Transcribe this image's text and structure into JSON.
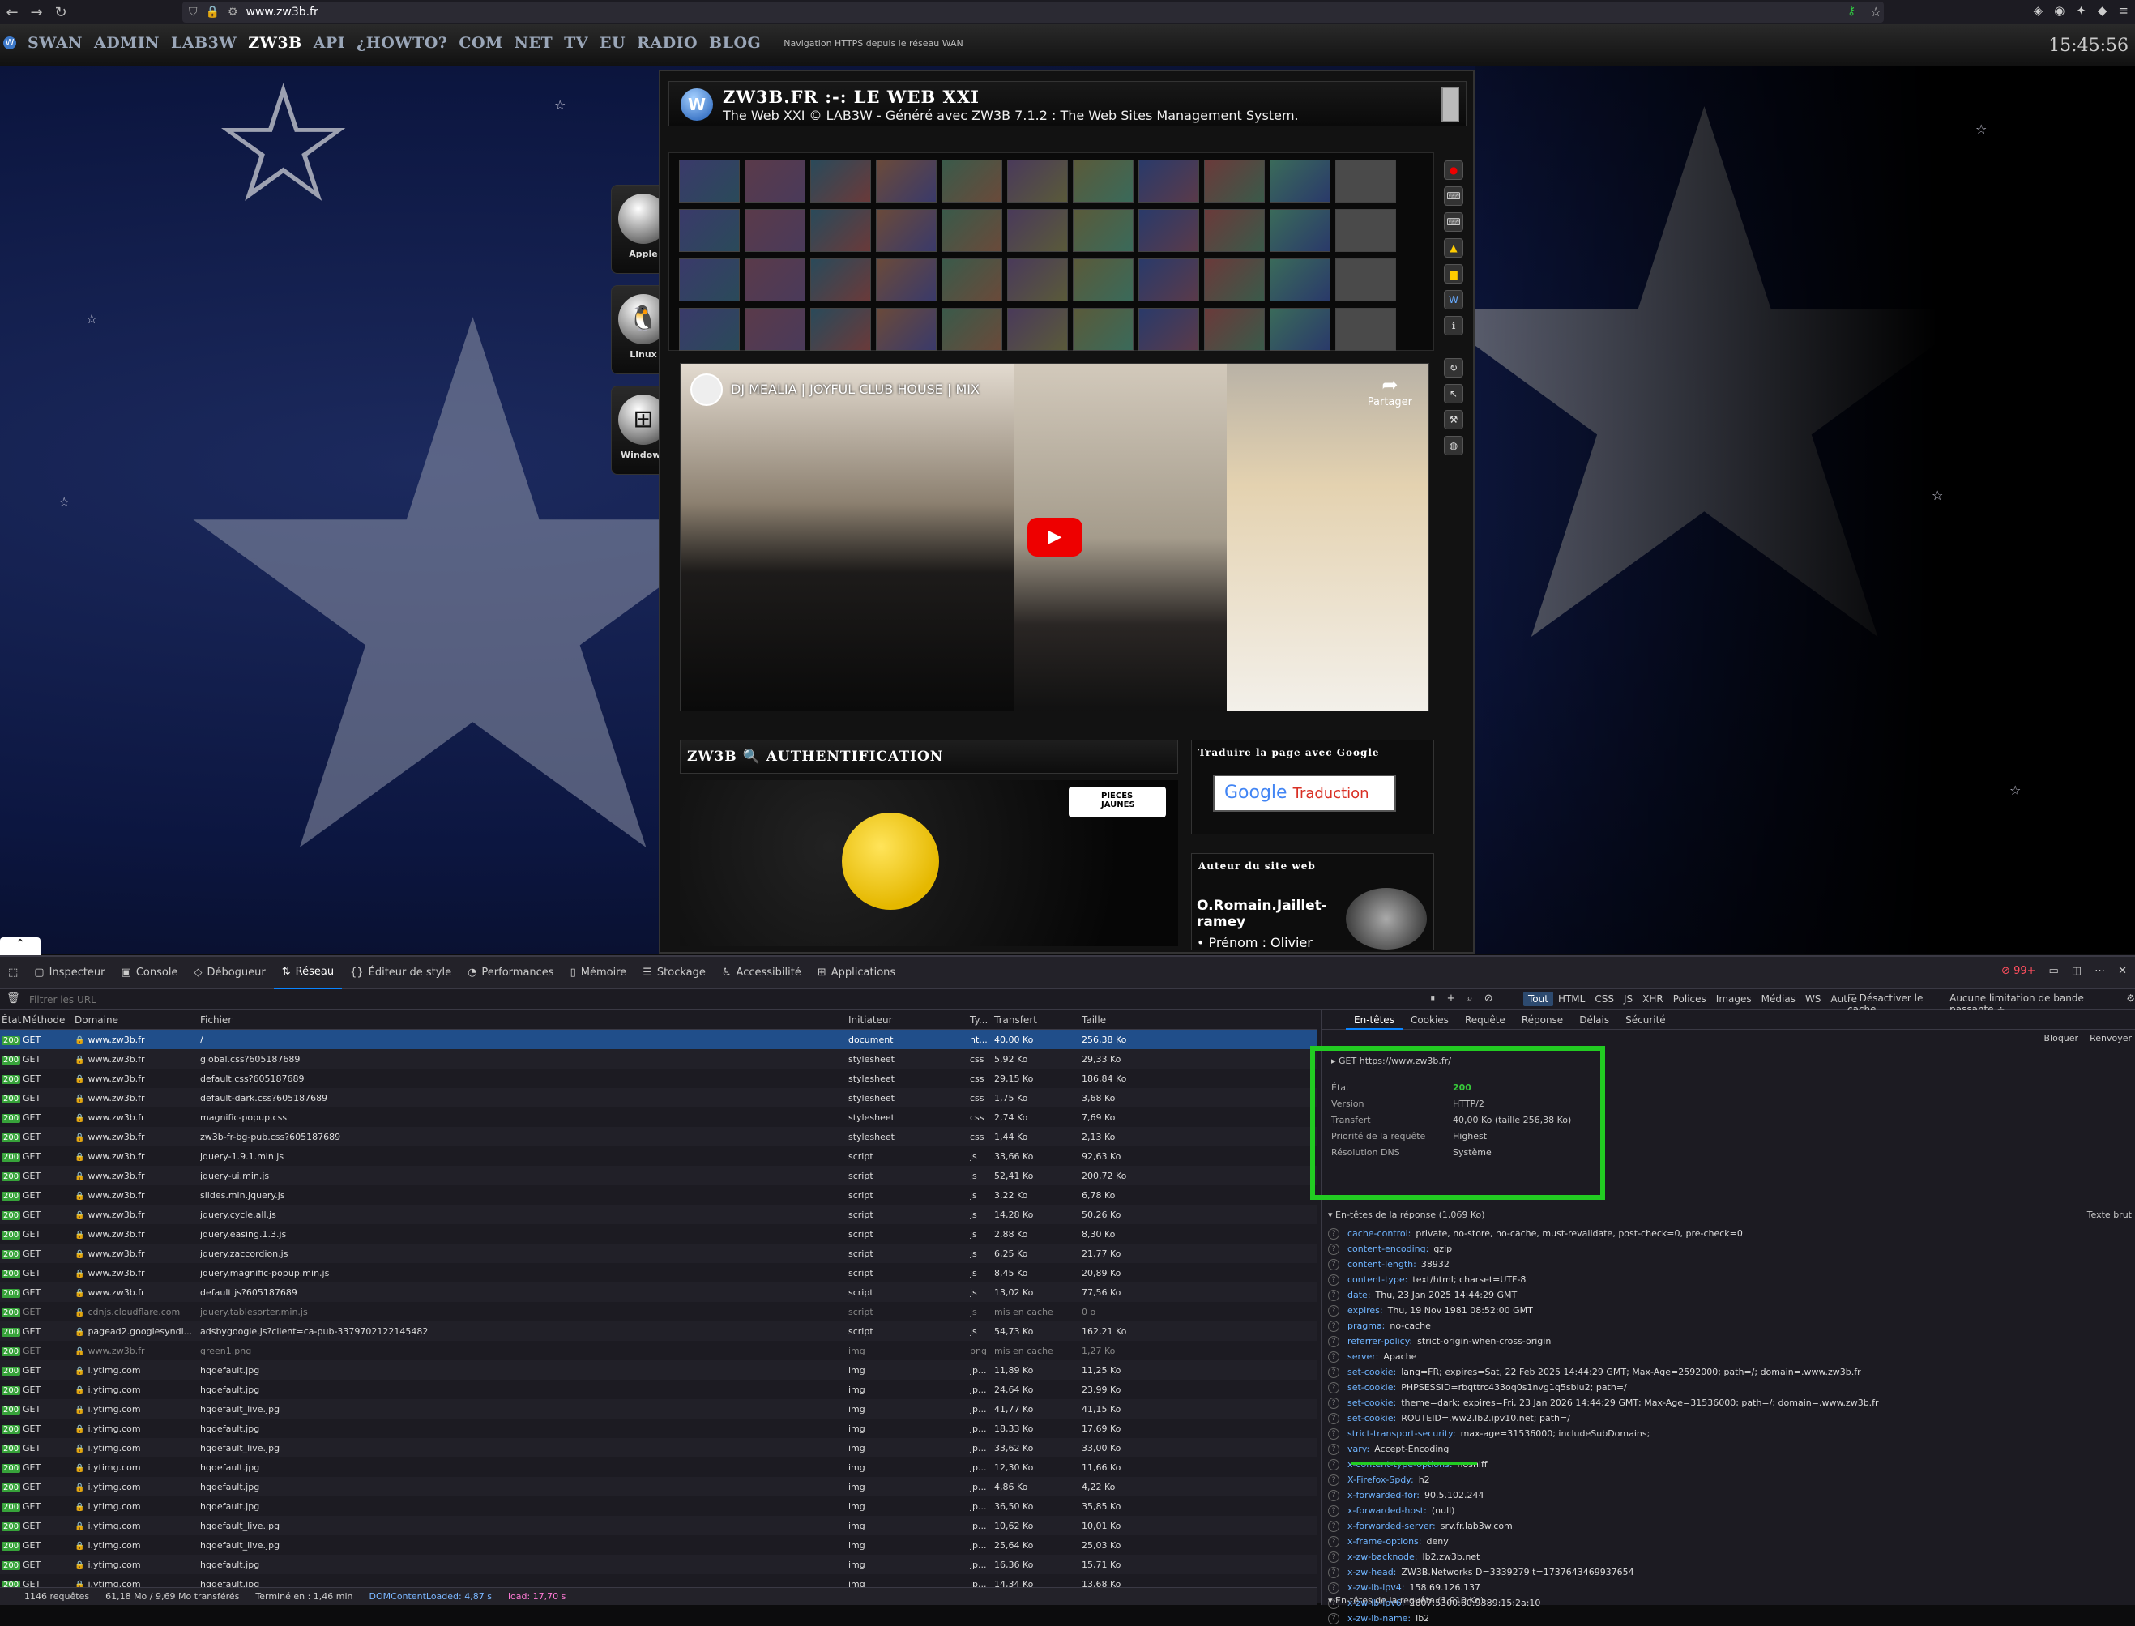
{
  "browser": {
    "url": "www.zw3b.fr",
    "nav_icons": [
      "back-icon",
      "forward-icon",
      "reload-icon"
    ]
  },
  "site": {
    "menu": [
      "SWAN",
      "ADMIN",
      "LAB3W",
      "ZW3B",
      "API",
      "¿HOWTO?",
      "COM",
      "NET",
      "TV",
      "EU",
      "RADIO",
      "BLOG"
    ],
    "active_menu": "ZW3B",
    "nav_note": "Navigation HTTPS depuis le réseau WAN",
    "clock": "15:45:56",
    "os_buttons": [
      "Apple",
      "Linux",
      "Windows"
    ],
    "panel_title": "ZW3B.FR :-: LE WEB XXI",
    "panel_subtitle": "The Web XXI © LAB3W - Généré avec ZW3B 7.1.2 : The Web Sites Management System.",
    "video_title": "DJ MEALIA | JOYFUL CLUB HOUSE | MIX",
    "share_label": "Partager",
    "auth_title": "ZW3B 🔍 AUTHENTIFICATION",
    "pieces_label": "PIECES JAUNES",
    "translate_title": "Traduire la page avec Google",
    "google_label": "Google",
    "traduction_label": "Traduction",
    "author_title": "Auteur du site web",
    "author_name": "O.Romain.Jaillet-ramey",
    "author_line": "• Prénom : Olivier"
  },
  "devtools": {
    "tabs": [
      "Inspecteur",
      "Console",
      "Débogueur",
      "Réseau",
      "Éditeur de style",
      "Performances",
      "Mémoire",
      "Stockage",
      "Accessibilité",
      "Applications"
    ],
    "active_tab": "Réseau",
    "error_count": "99+",
    "filter_placeholder": "Filtrer les URL",
    "filter_types": [
      "Tout",
      "HTML",
      "CSS",
      "JS",
      "XHR",
      "Polices",
      "Images",
      "Médias",
      "WS",
      "Autre"
    ],
    "disable_cache": "Désactiver le cache",
    "throttle": "Aucune limitation de bande passante ÷",
    "columns": [
      "État",
      "Méthode",
      "Domaine",
      "Fichier",
      "Initiateur",
      "Ty...",
      "Transfert",
      "Taille"
    ],
    "requests": [
      {
        "status": "200",
        "method": "GET",
        "domain": "www.zw3b.fr",
        "file": "/",
        "initiator": "document",
        "type": "ht...",
        "transfer": "40,00 Ko",
        "size": "256,38 Ko"
      },
      {
        "status": "200",
        "method": "GET",
        "domain": "www.zw3b.fr",
        "file": "global.css?605187689",
        "initiator": "stylesheet",
        "type": "css",
        "transfer": "5,92 Ko",
        "size": "29,33 Ko"
      },
      {
        "status": "200",
        "method": "GET",
        "domain": "www.zw3b.fr",
        "file": "default.css?605187689",
        "initiator": "stylesheet",
        "type": "css",
        "transfer": "29,15 Ko",
        "size": "186,84 Ko"
      },
      {
        "status": "200",
        "method": "GET",
        "domain": "www.zw3b.fr",
        "file": "default-dark.css?605187689",
        "initiator": "stylesheet",
        "type": "css",
        "transfer": "1,75 Ko",
        "size": "3,68 Ko"
      },
      {
        "status": "200",
        "method": "GET",
        "domain": "www.zw3b.fr",
        "file": "magnific-popup.css",
        "initiator": "stylesheet",
        "type": "css",
        "transfer": "2,74 Ko",
        "size": "7,69 Ko"
      },
      {
        "status": "200",
        "method": "GET",
        "domain": "www.zw3b.fr",
        "file": "zw3b-fr-bg-pub.css?605187689",
        "initiator": "stylesheet",
        "type": "css",
        "transfer": "1,44 Ko",
        "size": "2,13 Ko"
      },
      {
        "status": "200",
        "method": "GET",
        "domain": "www.zw3b.fr",
        "file": "jquery-1.9.1.min.js",
        "initiator": "script",
        "type": "js",
        "transfer": "33,66 Ko",
        "size": "92,63 Ko"
      },
      {
        "status": "200",
        "method": "GET",
        "domain": "www.zw3b.fr",
        "file": "jquery-ui.min.js",
        "initiator": "script",
        "type": "js",
        "transfer": "52,41 Ko",
        "size": "200,72 Ko"
      },
      {
        "status": "200",
        "method": "GET",
        "domain": "www.zw3b.fr",
        "file": "slides.min.jquery.js",
        "initiator": "script",
        "type": "js",
        "transfer": "3,22 Ko",
        "size": "6,78 Ko"
      },
      {
        "status": "200",
        "method": "GET",
        "domain": "www.zw3b.fr",
        "file": "jquery.cycle.all.js",
        "initiator": "script",
        "type": "js",
        "transfer": "14,28 Ko",
        "size": "50,26 Ko"
      },
      {
        "status": "200",
        "method": "GET",
        "domain": "www.zw3b.fr",
        "file": "jquery.easing.1.3.js",
        "initiator": "script",
        "type": "js",
        "transfer": "2,88 Ko",
        "size": "8,30 Ko"
      },
      {
        "status": "200",
        "method": "GET",
        "domain": "www.zw3b.fr",
        "file": "jquery.zaccordion.js",
        "initiator": "script",
        "type": "js",
        "transfer": "6,25 Ko",
        "size": "21,77 Ko"
      },
      {
        "status": "200",
        "method": "GET",
        "domain": "www.zw3b.fr",
        "file": "jquery.magnific-popup.min.js",
        "initiator": "script",
        "type": "js",
        "transfer": "8,45 Ko",
        "size": "20,89 Ko"
      },
      {
        "status": "200",
        "method": "GET",
        "domain": "www.zw3b.fr",
        "file": "default.js?605187689",
        "initiator": "script",
        "type": "js",
        "transfer": "13,02 Ko",
        "size": "77,56 Ko"
      },
      {
        "status": "200",
        "method": "GET",
        "domain": "cdnjs.cloudflare.com",
        "file": "jquery.tablesorter.min.js",
        "initiator": "script",
        "type": "js",
        "transfer": "mis en cache",
        "size": "0 o",
        "dim": true
      },
      {
        "status": "200",
        "method": "GET",
        "domain": "pagead2.googlesyndi...",
        "file": "adsbygoogle.js?client=ca-pub-3379702122145482",
        "initiator": "script",
        "type": "js",
        "transfer": "54,73 Ko",
        "size": "162,21 Ko"
      },
      {
        "status": "200",
        "method": "GET",
        "domain": "www.zw3b.fr",
        "file": "green1.png",
        "initiator": "img",
        "type": "png",
        "transfer": "mis en cache",
        "size": "1,27 Ko",
        "dim": true
      },
      {
        "status": "200",
        "method": "GET",
        "domain": "i.ytimg.com",
        "file": "hqdefault.jpg",
        "initiator": "img",
        "type": "jp...",
        "transfer": "11,89 Ko",
        "size": "11,25 Ko"
      },
      {
        "status": "200",
        "method": "GET",
        "domain": "i.ytimg.com",
        "file": "hqdefault.jpg",
        "initiator": "img",
        "type": "jp...",
        "transfer": "24,64 Ko",
        "size": "23,99 Ko"
      },
      {
        "status": "200",
        "method": "GET",
        "domain": "i.ytimg.com",
        "file": "hqdefault_live.jpg",
        "initiator": "img",
        "type": "jp...",
        "transfer": "41,77 Ko",
        "size": "41,15 Ko"
      },
      {
        "status": "200",
        "method": "GET",
        "domain": "i.ytimg.com",
        "file": "hqdefault.jpg",
        "initiator": "img",
        "type": "jp...",
        "transfer": "18,33 Ko",
        "size": "17,69 Ko"
      },
      {
        "status": "200",
        "method": "GET",
        "domain": "i.ytimg.com",
        "file": "hqdefault_live.jpg",
        "initiator": "img",
        "type": "jp...",
        "transfer": "33,62 Ko",
        "size": "33,00 Ko"
      },
      {
        "status": "200",
        "method": "GET",
        "domain": "i.ytimg.com",
        "file": "hqdefault.jpg",
        "initiator": "img",
        "type": "jp...",
        "transfer": "12,30 Ko",
        "size": "11,66 Ko"
      },
      {
        "status": "200",
        "method": "GET",
        "domain": "i.ytimg.com",
        "file": "hqdefault.jpg",
        "initiator": "img",
        "type": "jp...",
        "transfer": "4,86 Ko",
        "size": "4,22 Ko"
      },
      {
        "status": "200",
        "method": "GET",
        "domain": "i.ytimg.com",
        "file": "hqdefault.jpg",
        "initiator": "img",
        "type": "jp...",
        "transfer": "36,50 Ko",
        "size": "35,85 Ko"
      },
      {
        "status": "200",
        "method": "GET",
        "domain": "i.ytimg.com",
        "file": "hqdefault_live.jpg",
        "initiator": "img",
        "type": "jp...",
        "transfer": "10,62 Ko",
        "size": "10,01 Ko"
      },
      {
        "status": "200",
        "method": "GET",
        "domain": "i.ytimg.com",
        "file": "hqdefault_live.jpg",
        "initiator": "img",
        "type": "jp...",
        "transfer": "25,64 Ko",
        "size": "25,03 Ko"
      },
      {
        "status": "200",
        "method": "GET",
        "domain": "i.ytimg.com",
        "file": "hqdefault.jpg",
        "initiator": "img",
        "type": "jp...",
        "transfer": "16,36 Ko",
        "size": "15,71 Ko"
      },
      {
        "status": "200",
        "method": "GET",
        "domain": "i.ytimg.com",
        "file": "hqdefault.jpg",
        "initiator": "img",
        "type": "jp...",
        "transfer": "14,34 Ko",
        "size": "13,68 Ko"
      }
    ],
    "status_bar": {
      "requests": "1146 requêtes",
      "transferred": "61,18 Mo / 9,69 Mo transférés",
      "finished": "Terminé en : 1,46 min",
      "dcl": "DOMContentLoaded: 4,87 s",
      "load": "load: 17,70 s"
    },
    "detail_tabs": [
      "En-têtes",
      "Cookies",
      "Requête",
      "Réponse",
      "Délais",
      "Sécurité"
    ],
    "detail_active": "En-têtes",
    "detail_actions": [
      "Bloquer",
      "Renvoyer"
    ],
    "summary": {
      "url": "GET https://www.zw3b.fr/",
      "rows": [
        {
          "k": "État",
          "v": "200"
        },
        {
          "k": "Version",
          "v": "HTTP/2"
        },
        {
          "k": "Transfert",
          "v": "40,00 Ko (taille 256,38 Ko)"
        },
        {
          "k": "Priorité de la requête",
          "v": "Highest"
        },
        {
          "k": "Résolution DNS",
          "v": "Système"
        }
      ]
    },
    "response_headers_title": "▾ En-têtes de la réponse (1,069 Ko)",
    "raw_label": "Texte brut",
    "response_headers": [
      {
        "k": "cache-control:",
        "v": "private, no-store, no-cache, must-revalidate, post-check=0, pre-check=0"
      },
      {
        "k": "content-encoding:",
        "v": "gzip"
      },
      {
        "k": "content-length:",
        "v": "38932"
      },
      {
        "k": "content-type:",
        "v": "text/html; charset=UTF-8"
      },
      {
        "k": "date:",
        "v": "Thu, 23 Jan 2025 14:44:29 GMT"
      },
      {
        "k": "expires:",
        "v": "Thu, 19 Nov 1981 08:52:00 GMT"
      },
      {
        "k": "pragma:",
        "v": "no-cache"
      },
      {
        "k": "referrer-policy:",
        "v": "strict-origin-when-cross-origin"
      },
      {
        "k": "server:",
        "v": "Apache"
      },
      {
        "k": "set-cookie:",
        "v": "lang=FR; expires=Sat, 22 Feb 2025 14:44:29 GMT; Max-Age=2592000; path=/; domain=.www.zw3b.fr"
      },
      {
        "k": "set-cookie:",
        "v": "PHPSESSID=rbqttrc433oq0s1nvg1q5sblu2; path=/"
      },
      {
        "k": "set-cookie:",
        "v": "theme=dark; expires=Fri, 23 Jan 2026 14:44:29 GMT; Max-Age=31536000; path=/; domain=.www.zw3b.fr"
      },
      {
        "k": "set-cookie:",
        "v": "ROUTEID=.ww2.lb2.ipv10.net; path=/"
      },
      {
        "k": "strict-transport-security:",
        "v": "max-age=31536000; includeSubDomains;"
      },
      {
        "k": "vary:",
        "v": "Accept-Encoding"
      },
      {
        "k": "x-content-type-options:",
        "v": "nosniff"
      },
      {
        "k": "X-Firefox-Spdy:",
        "v": "h2"
      },
      {
        "k": "x-forwarded-for:",
        "v": "90.5.102.244"
      },
      {
        "k": "x-forwarded-host:",
        "v": "(null)"
      },
      {
        "k": "x-forwarded-server:",
        "v": "srv.fr.lab3w.com"
      },
      {
        "k": "x-frame-options:",
        "v": "deny"
      },
      {
        "k": "x-zw-backnode:",
        "v": "lb2.zw3b.net"
      },
      {
        "k": "x-zw-head:",
        "v": "ZW3B.Networks D=3339279 t=1737643469937654"
      },
      {
        "k": "x-zw-lb-ipv4:",
        "v": "158.69.126.137"
      },
      {
        "k": "x-zw-lb-ipv6:",
        "v": "2607:5300:60:9389:15:2a:10"
      },
      {
        "k": "x-zw-lb-name:",
        "v": "lb2"
      }
    ],
    "request_headers_title": "▾ En-têtes de la requête (1,910 Ko)",
    "accent": "#22cc22"
  }
}
